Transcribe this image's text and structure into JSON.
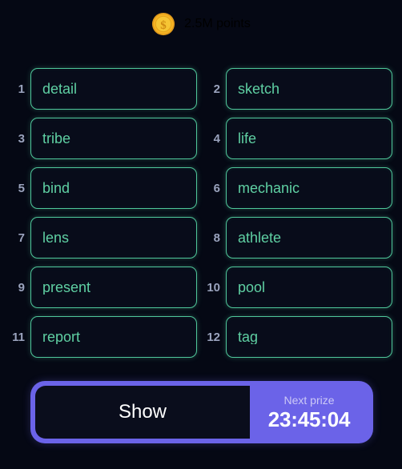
{
  "header": {
    "coin_icon": "coin-dollar-icon",
    "points_label": "2.5M points",
    "coin_colors": {
      "outer": "#f0a92a",
      "inner": "#f6c02e",
      "symbol": "#d58a16"
    }
  },
  "theme": {
    "background": "#050814",
    "word_border": "#4fc79a",
    "word_text": "#5fd0a3",
    "word_fill": "#080c1a",
    "index_text": "#9aa3bd",
    "accent_purple": "#6b63e8",
    "show_fill": "#0a0d1c"
  },
  "words": [
    {
      "index": "1",
      "text": "detail"
    },
    {
      "index": "2",
      "text": "sketch"
    },
    {
      "index": "3",
      "text": "tribe"
    },
    {
      "index": "4",
      "text": "life"
    },
    {
      "index": "5",
      "text": "bind"
    },
    {
      "index": "6",
      "text": "mechanic"
    },
    {
      "index": "7",
      "text": "lens"
    },
    {
      "index": "8",
      "text": "athlete"
    },
    {
      "index": "9",
      "text": "present"
    },
    {
      "index": "10",
      "text": "pool"
    },
    {
      "index": "11",
      "text": "report"
    },
    {
      "index": "12",
      "text": "tag"
    }
  ],
  "action_bar": {
    "show_label": "Show",
    "next_prize_label": "Next prize",
    "next_prize_timer": "23:45:04"
  }
}
